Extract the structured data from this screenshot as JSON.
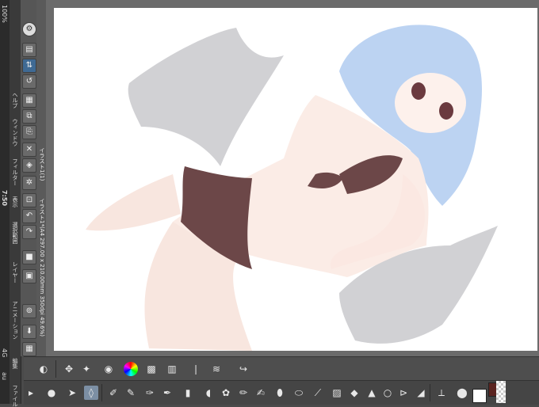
{
  "status": {
    "time": "7:50",
    "carrier": "au",
    "network": "4G",
    "battery": "100%"
  },
  "menu": {
    "items": [
      "ファイル",
      "編集",
      "アニメーション",
      "レイヤー",
      "選択範囲",
      "表示",
      "フィルター",
      "ウィンドウ",
      "ヘルプ"
    ]
  },
  "document": {
    "title": "イラスト1*(A4 297.00 x 210.00mm 350dpi 49.6%)",
    "tab_title": "イラスト1(1)"
  },
  "tools": {
    "icons": [
      "app-logo-icon",
      "layers-icon",
      "move-icon",
      "rotate-icon",
      "color-icon",
      "undo-icon",
      "redo-icon",
      "transform-icon",
      "selection-icon",
      "spray-icon"
    ]
  },
  "bottom_bar": {
    "row1_icons": [
      "rotate-view-icon",
      "move-layer-icon",
      "lasso-icon",
      "eye-icon",
      "color-wheel-icon",
      "color-set-icon",
      "color-history-icon",
      "fill-icon",
      "pen-icon",
      "reset-icon"
    ],
    "row2_icons": [
      "zoom-icon",
      "hand-icon",
      "select-icon",
      "pen-tool-icon",
      "brush-icon",
      "airbrush-icon",
      "decorate-icon",
      "eraser-icon",
      "blend-icon",
      "gradient-icon",
      "fill-tool-icon",
      "figure-icon",
      "text-icon",
      "balloon-icon",
      "ruler-icon",
      "line-icon",
      "brush-size-icon",
      "opacity-icon"
    ]
  },
  "colors": {
    "main_color": "#ffffff",
    "sub_color": "#5a2420",
    "accent": "#3f6a94"
  }
}
